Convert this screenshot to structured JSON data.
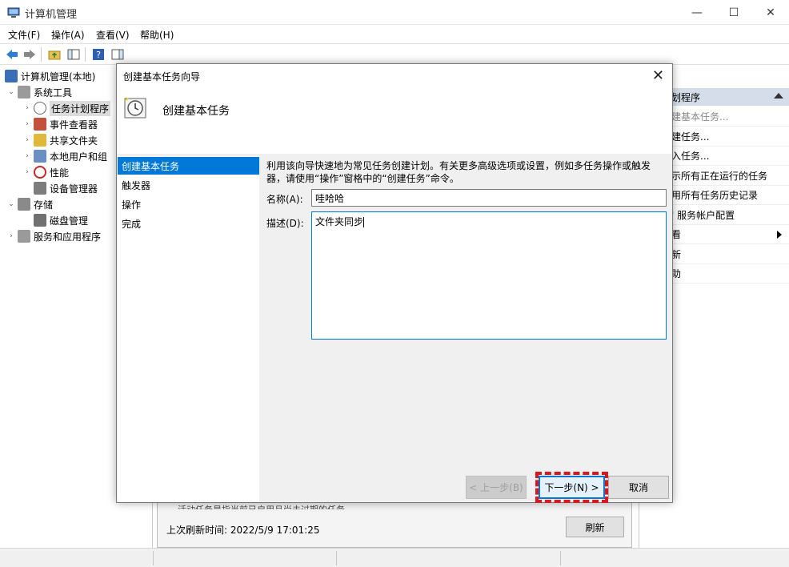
{
  "window": {
    "title": "计算机管理",
    "min": "—",
    "max": "☐",
    "close": "✕"
  },
  "menu": [
    "文件(F)",
    "操作(A)",
    "查看(V)",
    "帮助(H)"
  ],
  "tree": {
    "root": "计算机管理(本地)",
    "system_tools": "系统工具",
    "task_scheduler": "任务计划程序",
    "event_viewer": "事件查看器",
    "shared_folders": "共享文件夹",
    "local_users": "本地用户和组",
    "performance": "性能",
    "device_manager": "设备管理器",
    "storage": "存储",
    "disk_management": "磁盘管理",
    "services_apps": "服务和应用程序"
  },
  "center": {
    "cut_text": "活动任务是指当前已启用且尚未过期的任务。",
    "refresh_time": "上次刷新时间: 2022/5/9 17:01:25",
    "refresh_btn": "刷新"
  },
  "actions": {
    "header": "划程序",
    "items": [
      {
        "label": "建基本任务...",
        "grey": true
      },
      {
        "label": "建任务...",
        "grey": false
      },
      {
        "label": "入任务...",
        "grey": false
      },
      {
        "label": "示所有正在运行的任务",
        "grey": false
      },
      {
        "label": "用所有任务历史记录",
        "grey": false
      },
      {
        "label": "' 服务帐户配置",
        "grey": false
      },
      {
        "label": "看",
        "grey": false,
        "submenu": true
      },
      {
        "label": "新",
        "grey": false
      },
      {
        "label": "助",
        "grey": false
      }
    ]
  },
  "dialog": {
    "title": "创建基本任务向导",
    "heading": "创建基本任务",
    "close": "✕",
    "steps": [
      "创建基本任务",
      "触发器",
      "操作",
      "完成"
    ],
    "description": "利用该向导快速地为常见任务创建计划。有关更多高级选项或设置，例如多任务操作或触发器，请使用“操作”窗格中的“创建任务”命令。",
    "name_label": "名称(A):",
    "name_value": "哇哈哈",
    "desc_label": "描述(D):",
    "desc_value": "文件夹同步",
    "back_btn": "< 上一步(B)",
    "next_btn": "下一步(N) >",
    "cancel_btn": "取消"
  }
}
